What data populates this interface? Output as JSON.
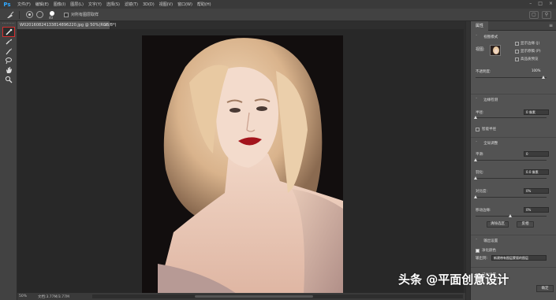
{
  "app": {
    "logo": "Ps",
    "menu": [
      "文件(F)",
      "编辑(E)",
      "图像(I)",
      "图层(L)",
      "文字(Y)",
      "选择(S)",
      "滤镜(T)",
      "3D(D)",
      "视图(V)",
      "窗口(W)",
      "帮助(H)"
    ]
  },
  "options": {
    "brush_size": "40",
    "sample_all_layers": "对所有图层取样"
  },
  "document": {
    "tab_title": "W020160824133814896220.jpg @ 50%(RGB/8*)",
    "zoom": "50%",
    "doc_size": "文档:3.77M/3.77M"
  },
  "properties": {
    "tab": "属性",
    "view_mode_label": "视图模式",
    "view_label": "视图:",
    "show_edge": "显示边缘 (J)",
    "show_original": "显示原稿 (P)",
    "high_quality_preview": "高品质预览",
    "opacity_label": "不透明度:",
    "opacity_value": "100%",
    "edge_detection_title": "边缘检测",
    "radius_label": "半径:",
    "radius_value": "0 像素",
    "smart_radius": "智能半径",
    "global_refine_title": "全局调整",
    "smooth_label": "平滑:",
    "smooth_value": "0",
    "feather_label": "羽化:",
    "feather_value": "0.0 像素",
    "contrast_label": "对比度:",
    "contrast_value": "0%",
    "shift_edge_label": "移动边缘:",
    "shift_edge_value": "0%",
    "clear_selection": "清除选区",
    "invert": "反相",
    "output_title": "输出设置",
    "decontaminate": "净化颜色",
    "output_to_label": "输出到:",
    "output_to_value": "新建带有图层蒙版的图层",
    "remember_settings": "记住设置",
    "ok": "确定"
  },
  "watermark": "头条 @平面创意设计",
  "colors": {
    "accent_selected_tool": "#d42f2f",
    "ps_blue": "#31a8ff",
    "lips": "#a3141c"
  }
}
